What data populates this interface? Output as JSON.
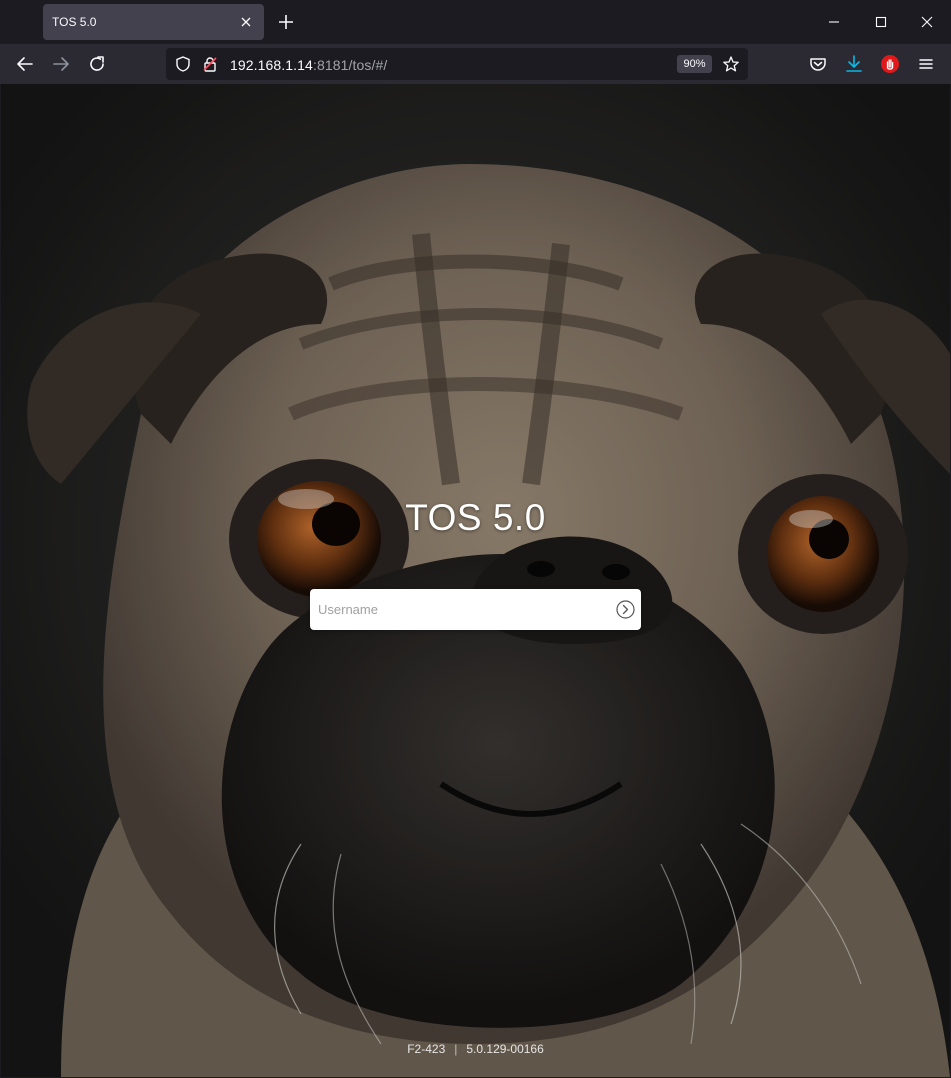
{
  "browser": {
    "tab": {
      "title": "TOS 5.0"
    },
    "url": {
      "host": "192.168.1.14",
      "rest": ":8181/tos/#/"
    },
    "zoom": "90%"
  },
  "icons": {
    "tab_close": "close-icon",
    "new_tab": "plus-icon",
    "minimize": "minimize-icon",
    "maximize": "maximize-icon",
    "close_window": "close-icon",
    "back": "arrow-left-icon",
    "forward": "arrow-right-icon",
    "reload": "reload-icon",
    "shield": "shield-icon",
    "insecure": "lock-slash-icon",
    "bookmark": "star-icon",
    "pocket": "pocket-icon",
    "downloads": "download-icon",
    "extension": "hand-stop-icon",
    "menu": "hamburger-menu-icon",
    "submit": "arrow-circle-right-icon"
  },
  "login": {
    "title": "TOS 5.0",
    "username_placeholder": "Username",
    "username_value": ""
  },
  "footer": {
    "model": "F2-423",
    "separator": "|",
    "version": "5.0.129-00166"
  },
  "colors": {
    "chrome_dark": "#1c1b22",
    "chrome_toolbar": "#2b2a33",
    "tab_active": "#42414d",
    "download_accent": "#0bb8e6",
    "extension_red": "#e01a1a"
  }
}
